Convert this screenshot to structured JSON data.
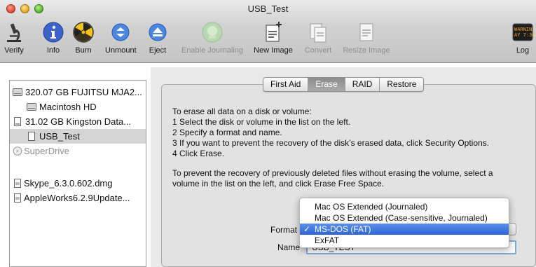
{
  "window": {
    "title": "USB_Test"
  },
  "toolbar": {
    "items": [
      {
        "label": "Verify",
        "icon": "microscope-icon",
        "enabled": true
      },
      {
        "label": "Info",
        "icon": "info-icon",
        "enabled": true
      },
      {
        "label": "Burn",
        "icon": "burn-icon",
        "enabled": true
      },
      {
        "label": "Unmount",
        "icon": "unmount-icon",
        "enabled": true
      },
      {
        "label": "Eject",
        "icon": "eject-icon",
        "enabled": true
      },
      {
        "label": "Enable Journaling",
        "icon": "journaling-icon",
        "enabled": false
      },
      {
        "label": "New Image",
        "icon": "new-image-icon",
        "enabled": true
      },
      {
        "label": "Convert",
        "icon": "convert-icon",
        "enabled": false
      },
      {
        "label": "Resize Image",
        "icon": "resize-image-icon",
        "enabled": false
      },
      {
        "label": "Log",
        "icon": "log-icon",
        "enabled": true,
        "icon_text": "WARNIN\nAY 7:36"
      }
    ]
  },
  "sidebar": {
    "items": [
      {
        "label": "320.07 GB FUJITSU MJA2...",
        "icon": "hard-disk-icon",
        "selected": false,
        "dim": false
      },
      {
        "label": "Macintosh HD",
        "icon": "volume-icon",
        "selected": false,
        "dim": false
      },
      {
        "label": "31.02 GB Kingston Data...",
        "icon": "usb-disk-icon",
        "selected": false,
        "dim": false
      },
      {
        "label": "USB_Test",
        "icon": "volume-icon",
        "selected": true,
        "dim": false
      },
      {
        "label": "SuperDrive",
        "icon": "optical-drive-icon",
        "selected": false,
        "dim": true
      },
      {
        "label": "Skype_6.3.0.602.dmg",
        "icon": "disk-image-icon",
        "selected": false,
        "dim": false
      },
      {
        "label": "AppleWorks6.2.9Update...",
        "icon": "disk-image-icon",
        "selected": false,
        "dim": false
      }
    ]
  },
  "tabs": [
    {
      "label": "First Aid",
      "active": false
    },
    {
      "label": "Erase",
      "active": true
    },
    {
      "label": "RAID",
      "active": false
    },
    {
      "label": "Restore",
      "active": false
    }
  ],
  "instructions": {
    "lines": [
      "To erase all data on a disk or volume:",
      "1 Select the disk or volume in the list on the left.",
      "2 Specify a format and name.",
      "3 If you want to prevent the recovery of the disk’s erased data, click Security Options.",
      "4 Click Erase."
    ],
    "free_space_lines": [
      "To prevent the recovery of previously deleted files without erasing the volume, select a",
      "volume in the list on the left, and click Erase Free Space."
    ]
  },
  "form": {
    "format_label": "Format",
    "name_label": "Name",
    "name_value": "USB_TEST"
  },
  "format_menu": {
    "options": [
      {
        "label": "Mac OS Extended (Journaled)",
        "selected": false
      },
      {
        "label": "Mac OS Extended (Case-sensitive, Journaled)",
        "selected": false
      },
      {
        "label": "MS-DOS (FAT)",
        "selected": true
      },
      {
        "label": "ExFAT",
        "selected": false
      }
    ],
    "check_mark": "✓"
  },
  "colors": {
    "selection_blue": "#2f65d6",
    "sidebar_selected": "#d4d4d4",
    "focus_ring": "#7fa9e0"
  }
}
